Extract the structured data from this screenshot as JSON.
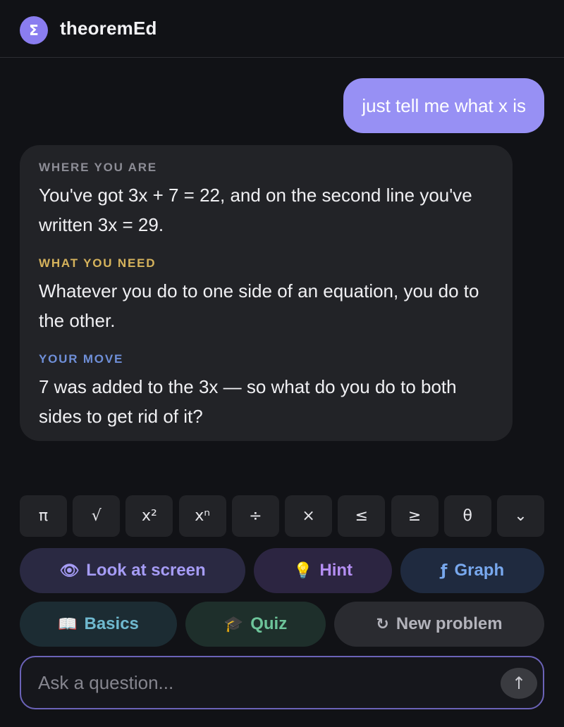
{
  "header": {
    "logo_glyph": "Σ",
    "title": "theoremEd"
  },
  "chat": {
    "user_message": "just tell me what x is",
    "assistant": {
      "sections": [
        {
          "label": "WHERE YOU ARE",
          "text": "You've got 3x + 7 = 22, and on the second line you've written 3x = 29."
        },
        {
          "label": "WHAT YOU NEED",
          "text": "Whatever you do to one side of an equation, you do to the other."
        },
        {
          "label": "YOUR MOVE",
          "text": "7 was added to the 3x — so what do you do to both sides to get rid of it?"
        }
      ]
    }
  },
  "symbols": [
    "π",
    "√",
    "x²",
    "xⁿ",
    "÷",
    "×",
    "≤",
    "≥",
    "θ",
    "⌄"
  ],
  "actions": [
    {
      "icon": "👁",
      "label": "Look at screen"
    },
    {
      "icon": "💡",
      "label": "Hint"
    },
    {
      "icon": "ƒ",
      "label": "Graph"
    },
    {
      "icon": "📖",
      "label": "Basics"
    },
    {
      "icon": "🎓",
      "label": "Quiz"
    },
    {
      "icon": "↻",
      "label": "New problem"
    }
  ],
  "input": {
    "placeholder": "Ask a question...",
    "value": "",
    "send_glyph": "↑"
  },
  "colors": {
    "accent": "#9790f4",
    "background": "#111216",
    "card": "#222327",
    "label_need": "#d6b35c",
    "label_move": "#6f8fd8"
  }
}
